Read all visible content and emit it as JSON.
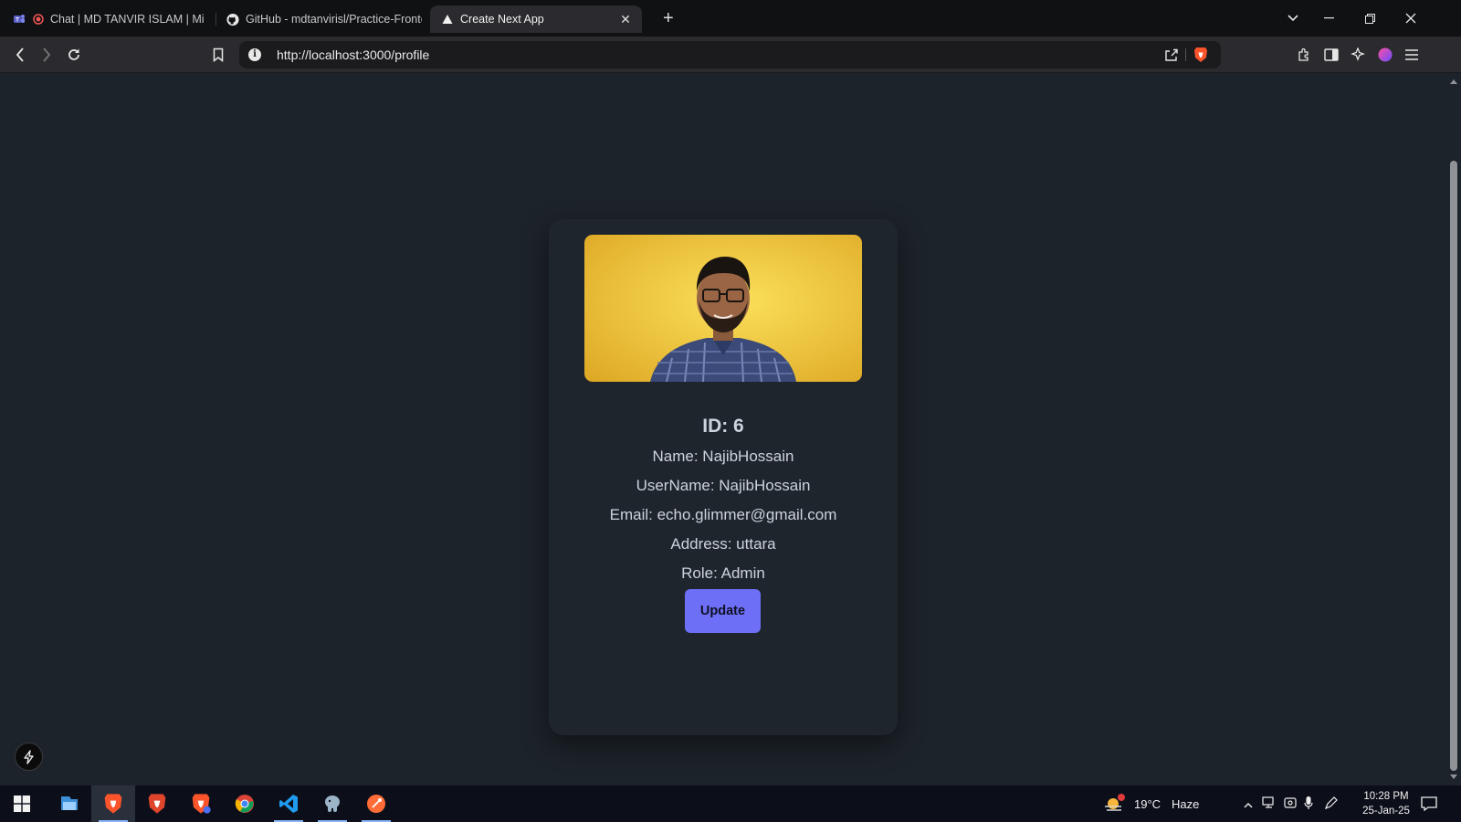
{
  "browser": {
    "tabs": [
      {
        "title": "Chat | MD TANVIR ISLAM | Micr",
        "icon": "teams-icon"
      },
      {
        "title": "GitHub - mdtanvirisl/Practice-Fronte",
        "icon": "github-icon"
      },
      {
        "title": "Create Next App",
        "icon": "nextjs-icon",
        "active": true
      }
    ],
    "url": "http://localhost:3000/profile"
  },
  "profile": {
    "id_line": "ID: 6",
    "name_line": "Name: NajibHossain",
    "username_line": "UserName: NajibHossain",
    "email_line": "Email: echo.glimmer@gmail.com",
    "address_line": "Address: uttara",
    "role_line": "Role: Admin",
    "update_label": "Update"
  },
  "taskbar": {
    "apps": [
      "windows-start-icon",
      "file-explorer-icon",
      "brave-icon",
      "brave-beta-icon",
      "brave-nightly-icon",
      "chrome-icon",
      "vscode-icon",
      "pgadmin-icon",
      "postman-icon"
    ],
    "weather_temp": "19°C",
    "weather_desc": "Haze",
    "time": "10:28 PM",
    "date": "25-Jan-25"
  },
  "colors": {
    "page_bg": "#1d232a",
    "card_bg": "#1f252d",
    "button": "#6d6ff7",
    "photo_bg": "#f2cb3a"
  }
}
